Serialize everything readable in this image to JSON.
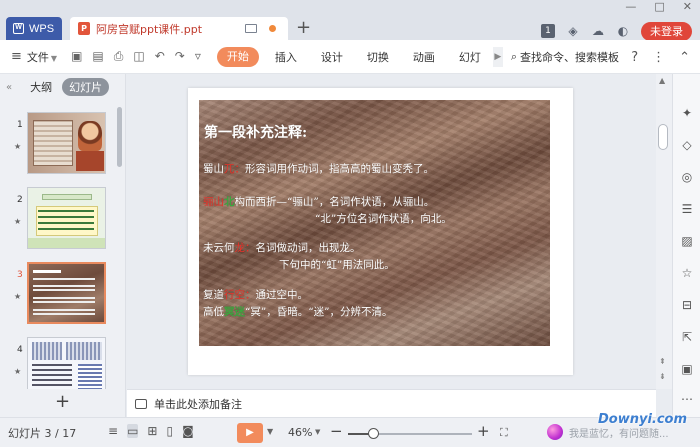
{
  "titlebar": {
    "app_tab": "WPS",
    "doc_tab": "阿房宫赋ppt课件.ppt",
    "badge_num": "1",
    "login": "未登录"
  },
  "menubar": {
    "file": "文件",
    "start": "开始",
    "items": [
      "插入",
      "设计",
      "切换",
      "动画",
      "幻灯"
    ],
    "search": "查找命令、搜索模板"
  },
  "left_panel": {
    "tab_outline": "大纲",
    "tab_slides": "幻灯片",
    "thumbs": [
      {
        "num": "1"
      },
      {
        "num": "2"
      },
      {
        "num": "3"
      },
      {
        "num": "4"
      }
    ]
  },
  "slide": {
    "heading": "第一段补充注释:",
    "l1a": "蜀山",
    "l1b": "兀：",
    "l1c": "形容词用作动词，指高高的蜀山变秃了。",
    "l2a": "骊山",
    "l2b": "北",
    "l2c": "构而西折—“骊山”，名词作状语，从骊山。",
    "l3": "“北”方位名词作状语，向北。",
    "l4a": "未云何",
    "l4b": "龙：",
    "l4c": "名词做动词，出现龙。",
    "l5": "下句中的“虹”用法同此。",
    "l6a": "复道",
    "l6b": "行空：",
    "l6c": "通过空中。",
    "l7a": "高低",
    "l7b": "冥迷",
    "l7c": "“冥”，昏暗。“迷”，分辨不清。"
  },
  "notes": "单击此处添加备注",
  "status": {
    "slide_counter": "幻灯片 3 / 17",
    "zoom": "46%",
    "zoom_level_fraction": 0.2,
    "assistant": "我是蓝忆，有问题随..."
  },
  "watermark": "Downyi.com",
  "colors": {
    "wps_blue": "#3d5ba9",
    "accent_orange": "#f28b5c",
    "login_red": "#e0463a",
    "slide_red": "#e8352c",
    "slide_green": "#3da53f"
  },
  "icons": {
    "add_tab": "+",
    "add_slide": "+"
  }
}
